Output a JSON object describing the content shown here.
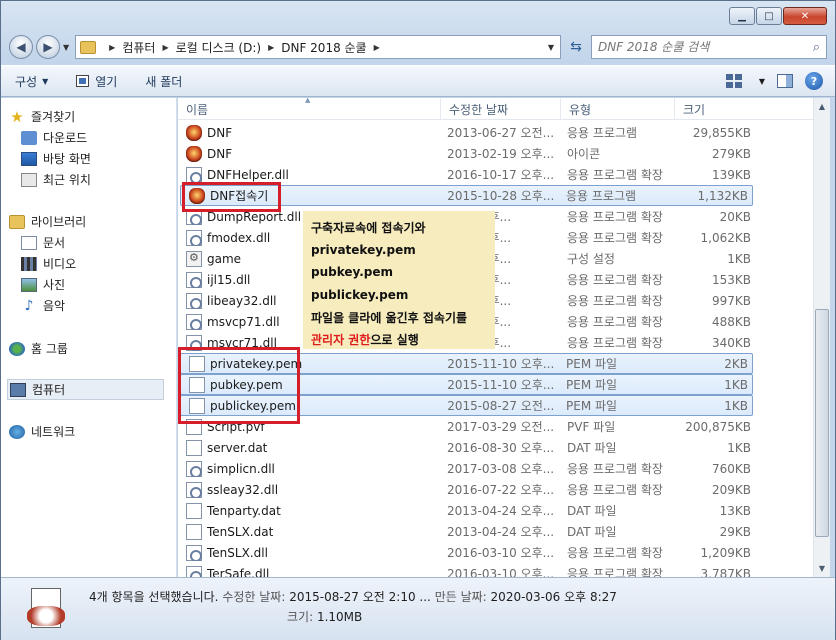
{
  "window": {
    "minimize": "▁",
    "maximize": "□",
    "close": "✕"
  },
  "address": {
    "back_icon": "back-arrow",
    "forward_icon": "forward-arrow",
    "crumbs": [
      "컴퓨터",
      "로컬 디스크 (D:)",
      "DNF 2018 순쿨"
    ],
    "search_placeholder": "DNF 2018 순쿨 검색"
  },
  "toolbar": {
    "organize": "구성",
    "open": "열기",
    "new_folder": "새 폴더"
  },
  "nav": {
    "favorites": "즐겨찾기",
    "downloads": "다운로드",
    "desktop": "바탕 화면",
    "recent": "최근 위치",
    "libraries": "라이브러리",
    "documents": "문서",
    "videos": "비디오",
    "pictures": "사진",
    "music": "음악",
    "homegroup": "홈 그룹",
    "computer": "컴퓨터",
    "network": "네트워크"
  },
  "columns": {
    "name": "이름",
    "date": "수정한 날짜",
    "type": "유형",
    "size": "크기"
  },
  "files": [
    {
      "name": "DNF",
      "date": "2013-06-27 오전...",
      "type": "응용 프로그램",
      "size": "29,855KB",
      "icon": "app"
    },
    {
      "name": "DNF",
      "date": "2013-02-19 오후...",
      "type": "아이콘",
      "size": "279KB",
      "icon": "app"
    },
    {
      "name": "DNFHelper.dll",
      "date": "2016-10-17 오후...",
      "type": "응용 프로그램 확장",
      "size": "139KB",
      "icon": "dll"
    },
    {
      "name": "DNF접속기",
      "date": "2015-10-28 오후...",
      "type": "응용 프로그램",
      "size": "1,132KB",
      "icon": "app",
      "selected": true
    },
    {
      "name": "DumpReport.dll",
      "date": "...14 오후...",
      "type": "응용 프로그램 확장",
      "size": "20KB",
      "icon": "dll"
    },
    {
      "name": "fmodex.dll",
      "date": "...08 오후...",
      "type": "응용 프로그램 확장",
      "size": "1,062KB",
      "icon": "dll"
    },
    {
      "name": "game",
      "date": "...14 오후...",
      "type": "구성 설정",
      "size": "1KB",
      "icon": "ini"
    },
    {
      "name": "ijl15.dll",
      "date": "...06 오후...",
      "type": "응용 프로그램 확장",
      "size": "153KB",
      "icon": "dll"
    },
    {
      "name": "libeay32.dll",
      "date": "...22 오후...",
      "type": "응용 프로그램 확장",
      "size": "997KB",
      "icon": "dll"
    },
    {
      "name": "msvcp71.dll",
      "date": "...14 오후...",
      "type": "응용 프로그램 확장",
      "size": "488KB",
      "icon": "dll"
    },
    {
      "name": "msvcr71.dll",
      "date": "...14 오후...",
      "type": "응용 프로그램 확장",
      "size": "340KB",
      "icon": "dll"
    },
    {
      "name": "privatekey.pem",
      "date": "2015-11-10 오후...",
      "type": "PEM 파일",
      "size": "2KB",
      "icon": "doc",
      "selected": true
    },
    {
      "name": "pubkey.pem",
      "date": "2015-11-10 오후...",
      "type": "PEM 파일",
      "size": "1KB",
      "icon": "doc",
      "selected": true
    },
    {
      "name": "publickey.pem",
      "date": "2015-08-27 오전...",
      "type": "PEM 파일",
      "size": "1KB",
      "icon": "doc",
      "selected": true
    },
    {
      "name": "Script.pvf",
      "date": "2017-03-29 오전...",
      "type": "PVF 파일",
      "size": "200,875KB",
      "icon": "doc"
    },
    {
      "name": "server.dat",
      "date": "2016-08-30 오후...",
      "type": "DAT 파일",
      "size": "1KB",
      "icon": "doc"
    },
    {
      "name": "simplicn.dll",
      "date": "2017-03-08 오후...",
      "type": "응용 프로그램 확장",
      "size": "760KB",
      "icon": "dll"
    },
    {
      "name": "ssleay32.dll",
      "date": "2016-07-22 오후...",
      "type": "응용 프로그램 확장",
      "size": "209KB",
      "icon": "dll"
    },
    {
      "name": "Tenparty.dat",
      "date": "2013-04-24 오후...",
      "type": "DAT 파일",
      "size": "13KB",
      "icon": "doc"
    },
    {
      "name": "TenSLX.dat",
      "date": "2013-04-24 오후...",
      "type": "DAT 파일",
      "size": "29KB",
      "icon": "doc"
    },
    {
      "name": "TenSLX.dll",
      "date": "2016-03-10 오후...",
      "type": "응용 프로그램 확장",
      "size": "1,209KB",
      "icon": "dll"
    },
    {
      "name": "TerSafe.dll",
      "date": "2016-03-10 오후...",
      "type": "응용 프로그램 확장",
      "size": "3,787KB",
      "icon": "dll"
    }
  ],
  "note": {
    "line1": "구축자료속에 접속기와",
    "line2": "privatekey.pem",
    "line3": "pubkey.pem",
    "line4": "publickey.pem",
    "line5": "파일을 클라에 옮긴후 접속기를",
    "line6_red": "관리자 권한",
    "line6_rest": "으로 실행"
  },
  "details": {
    "summary": "4개 항목을 선택했습니다.",
    "modified_label": "수정한 날짜:",
    "modified_value": "2015-08-27 오전 2:10 ...",
    "created_label": "만든 날짜:",
    "created_value": "2020-03-06 오후 8:27",
    "size_label": "크기:",
    "size_value": "1.10MB"
  },
  "colors": {
    "highlight_border": "#d51e2a",
    "note_bg": "#f6ecbe",
    "note_red": "#e01b1b"
  }
}
